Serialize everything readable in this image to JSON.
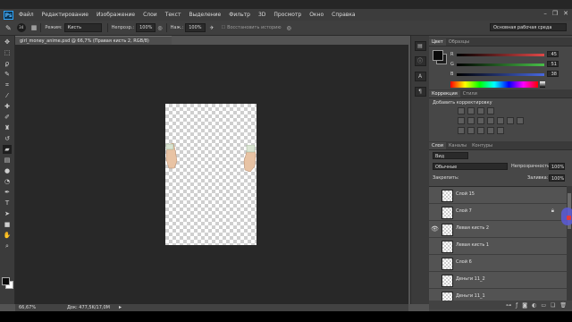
{
  "app": {
    "logo": "Ps"
  },
  "menubar": {
    "items": [
      "Файл",
      "Редактирование",
      "Изображение",
      "Слои",
      "Текст",
      "Выделение",
      "Фильтр",
      "3D",
      "Просмотр",
      "Окно",
      "Справка"
    ],
    "window_controls": [
      "–",
      "❐",
      "✕"
    ]
  },
  "options_bar": {
    "brush_size": "34",
    "mode_label": "Режим:",
    "mode_value": "Кисть",
    "opacity_label": "Непрозр.:",
    "opacity_value": "100%",
    "pressure_label": "Наж.:",
    "pressure_value": "100%",
    "erase_history_label": "Восстановить историю",
    "workspace": "Основная рабочая среда"
  },
  "document": {
    "tab_title": "girl_money_anime.psd @ 66,7% (Правая кисть 2, RGB/8)",
    "zoom": "66,67%",
    "doc_info": "Док: 477,5K/17,0M"
  },
  "color_panel": {
    "tabs": [
      "Цвет",
      "Образцы"
    ],
    "sliders": [
      {
        "label": "R",
        "value": "45",
        "color": "#e04848"
      },
      {
        "label": "G",
        "value": "51",
        "color": "#48c048"
      },
      {
        "label": "B",
        "value": "38",
        "color": "#4868e0"
      }
    ]
  },
  "adjustments_panel": {
    "tabs": [
      "Коррекция",
      "Стили"
    ],
    "title": "Добавить корректировку"
  },
  "layers_panel": {
    "tabs": [
      "Слои",
      "Каналы",
      "Контуры"
    ],
    "filter_value": "Вид",
    "blend_mode": "Обычные",
    "opacity_label": "Непрозрачность:",
    "opacity_value": "100%",
    "lock_label": "Закрепить:",
    "fill_label": "Заливка:",
    "fill_value": "100%",
    "layers": [
      {
        "name": "Слой 15",
        "visible": false,
        "locked": false
      },
      {
        "name": "Слой 7",
        "visible": false,
        "locked": true
      },
      {
        "name": "Левая кисть 2",
        "visible": true,
        "locked": false
      },
      {
        "name": "Левая кисть 1",
        "visible": false,
        "locked": false
      },
      {
        "name": "Слой 6",
        "visible": false,
        "locked": false
      },
      {
        "name": "Деньги 11_2",
        "visible": false,
        "locked": false
      },
      {
        "name": "Деньги 11_1",
        "visible": false,
        "locked": false
      }
    ],
    "footer_icons": [
      "link-icon",
      "fx-icon",
      "mask-icon",
      "adjustment-icon",
      "folder-icon",
      "new-layer-icon",
      "trash-icon"
    ]
  },
  "toolbar": {
    "tools": [
      "move-icon",
      "marquee-icon",
      "lasso-icon",
      "quick-select-icon",
      "crop-icon",
      "eyedropper-icon",
      "healing-icon",
      "brush-icon",
      "clone-stamp-icon",
      "history-brush-icon",
      "eraser-icon",
      "gradient-icon",
      "blur-icon",
      "dodge-icon",
      "pen-icon",
      "type-icon",
      "path-select-icon",
      "shape-icon",
      "hand-icon",
      "zoom-icon"
    ]
  }
}
